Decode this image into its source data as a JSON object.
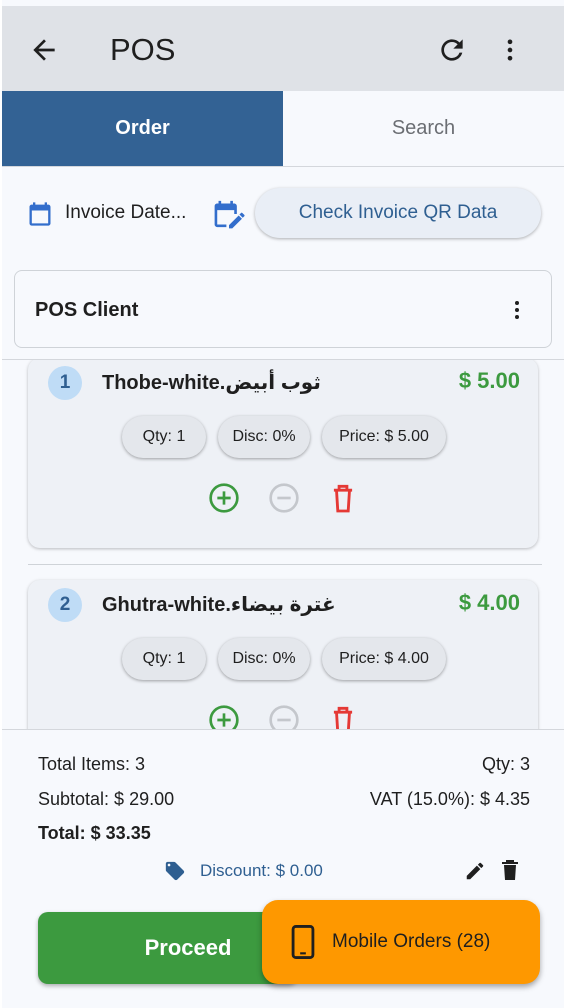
{
  "appbar": {
    "title": "POS",
    "back_icon": "arrow-back-icon",
    "refresh_icon": "refresh-icon",
    "more_icon": "more-vert-icon"
  },
  "tabs": [
    {
      "label": "Order",
      "active": true
    },
    {
      "label": "Search",
      "active": false
    }
  ],
  "invoice": {
    "date_label": "Invoice Date...",
    "qr_button": "Check Invoice QR Data"
  },
  "client": {
    "name": "POS Client"
  },
  "items": [
    {
      "index": "1",
      "name": "Thobe-white.ثوب أبيض",
      "total": "$ 5.00",
      "qty": "Qty: 1",
      "disc": "Disc: 0%",
      "price": "Price: $ 5.00"
    },
    {
      "index": "2",
      "name": "Ghutra-white.غترة بيضاء",
      "total": "$ 4.00",
      "qty": "Qty: 1",
      "disc": "Disc: 0%",
      "price": "Price: $ 4.00"
    }
  ],
  "summary": {
    "total_items": "Total Items: 3",
    "qty": "Qty: 3",
    "subtotal": "Subtotal: $ 29.00",
    "vat": "VAT (15.0%): $ 4.35",
    "total": "Total: $ 33.35",
    "discount": "Discount: $ 0.00"
  },
  "buttons": {
    "proceed": "Proceed",
    "mobile_orders": "Mobile Orders (28)"
  },
  "colors": {
    "primary": "#336294",
    "green": "#3c9a3f",
    "red": "#e53935",
    "orange": "#fe9800",
    "chip": "#e4e7ec"
  }
}
